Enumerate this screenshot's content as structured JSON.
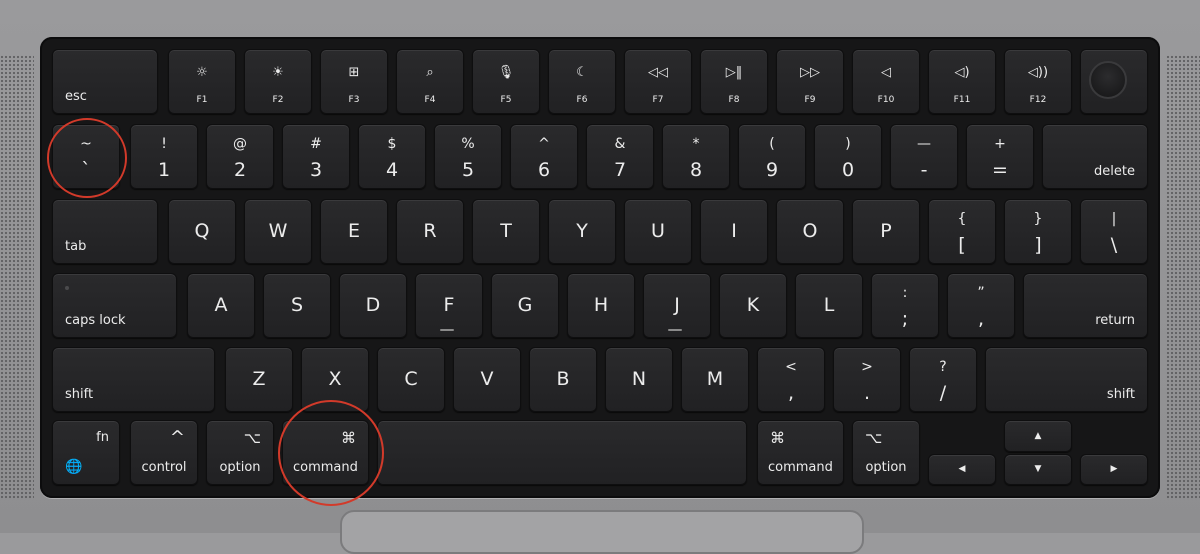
{
  "keyboard": {
    "fn_row": {
      "esc": "esc",
      "keys": [
        {
          "icon": "☼",
          "label": "F1",
          "icon_name": "brightness-down-icon"
        },
        {
          "icon": "☀",
          "label": "F2",
          "icon_name": "brightness-up-icon"
        },
        {
          "icon": "⊞",
          "label": "F3",
          "icon_name": "mission-control-icon"
        },
        {
          "icon": "⌕",
          "label": "F4",
          "icon_name": "search-icon"
        },
        {
          "icon": "🎙",
          "label": "F5",
          "icon_name": "microphone-icon"
        },
        {
          "icon": "☾",
          "label": "F6",
          "icon_name": "moon-icon"
        },
        {
          "icon": "◁◁",
          "label": "F7",
          "icon_name": "rewind-icon"
        },
        {
          "icon": "▷‖",
          "label": "F8",
          "icon_name": "play-pause-icon"
        },
        {
          "icon": "▷▷",
          "label": "F9",
          "icon_name": "fast-forward-icon"
        },
        {
          "icon": "◁",
          "label": "F10",
          "icon_name": "mute-icon"
        },
        {
          "icon": "◁)",
          "label": "F11",
          "icon_name": "volume-down-icon"
        },
        {
          "icon": "◁))",
          "label": "F12",
          "icon_name": "volume-up-icon"
        }
      ]
    },
    "number_row": {
      "tilde_top": "~",
      "tilde_bottom": "`",
      "keys": [
        {
          "top": "!",
          "bottom": "1"
        },
        {
          "top": "@",
          "bottom": "2"
        },
        {
          "top": "#",
          "bottom": "3"
        },
        {
          "top": "$",
          "bottom": "4"
        },
        {
          "top": "%",
          "bottom": "5"
        },
        {
          "top": "^",
          "bottom": "6"
        },
        {
          "top": "&",
          "bottom": "7"
        },
        {
          "top": "*",
          "bottom": "8"
        },
        {
          "top": "(",
          "bottom": "9"
        },
        {
          "top": ")",
          "bottom": "0"
        },
        {
          "top": "—",
          "bottom": "-"
        },
        {
          "top": "+",
          "bottom": "="
        }
      ],
      "delete": "delete"
    },
    "qwerty_row": {
      "tab": "tab",
      "letters": [
        "Q",
        "W",
        "E",
        "R",
        "T",
        "Y",
        "U",
        "I",
        "O",
        "P"
      ],
      "brackets": [
        {
          "top": "{",
          "bottom": "["
        },
        {
          "top": "}",
          "bottom": "]"
        },
        {
          "top": "|",
          "bottom": "\\"
        }
      ]
    },
    "home_row": {
      "caps": "caps lock",
      "letters": [
        "A",
        "S",
        "D",
        "F",
        "G",
        "H",
        "J",
        "K",
        "L"
      ],
      "semicolon": {
        "top": ":",
        "bottom": ";"
      },
      "quote": {
        "top": "”",
        "bottom": ","
      },
      "return": "return"
    },
    "bottom_letter_row": {
      "shift_left": "shift",
      "letters": [
        "Z",
        "X",
        "C",
        "V",
        "B",
        "N",
        "M"
      ],
      "punct": [
        {
          "top": "<",
          "bottom": ","
        },
        {
          "top": ">",
          "bottom": "."
        },
        {
          "top": "?",
          "bottom": "/"
        }
      ],
      "shift_right": "shift"
    },
    "modifier_row": {
      "fn": "fn",
      "globe_icon": "🌐",
      "control_sym": "^",
      "control": "control",
      "option_sym": "⌥",
      "option": "option",
      "command_sym": "⌘",
      "command": "command",
      "command_r_sym": "⌘",
      "command_r": "command",
      "option_r_sym": "⌥",
      "option_r": "option",
      "arrow_up": "▲",
      "arrow_left": "◀",
      "arrow_down": "▼",
      "arrow_right": "▶"
    }
  },
  "annotation_color": "#d23a2a"
}
